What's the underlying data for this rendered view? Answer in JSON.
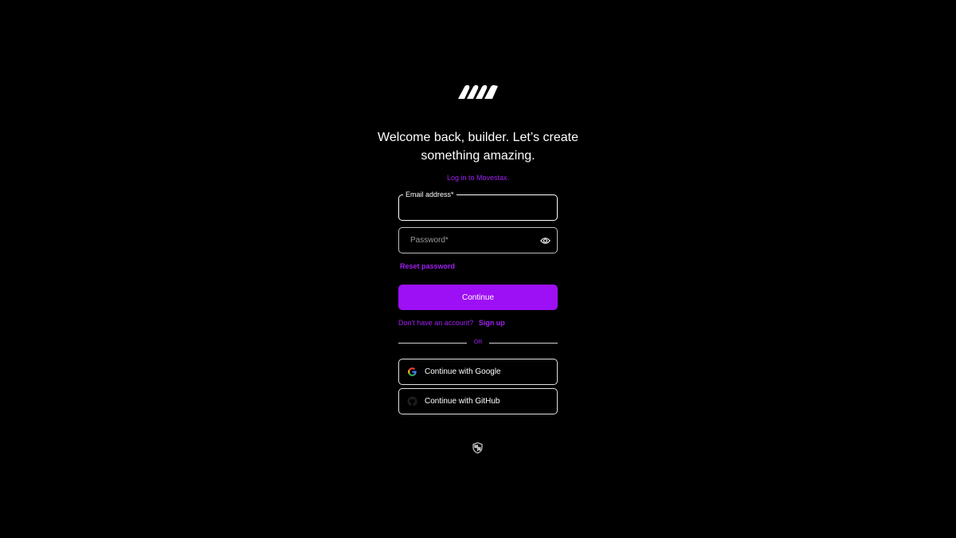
{
  "brand": {
    "logo_icon": "movestax-logo-icon"
  },
  "header": {
    "headline": "Welcome back, builder. Let’s create something amazing.",
    "subline": "Log in to Movestax."
  },
  "form": {
    "email_label": "Email address*",
    "email_value": "",
    "password_placeholder": "Password*",
    "password_value": "",
    "password_toggle_icon": "eye-icon",
    "reset_label": "Reset password",
    "continue_label": "Continue",
    "signup_prompt": "Don't have an account?",
    "signup_link": "Sign up",
    "divider_text": "OR"
  },
  "social": {
    "google_label": "Continue with Google",
    "google_icon": "google-icon",
    "github_label": "Continue with GitHub",
    "github_icon": "github-icon"
  },
  "footer": {
    "security_icon": "shield-icon"
  },
  "colors": {
    "background": "#000000",
    "accent": "#9d0ff5",
    "accent_text": "#a020f0",
    "text": "#ffffff"
  }
}
